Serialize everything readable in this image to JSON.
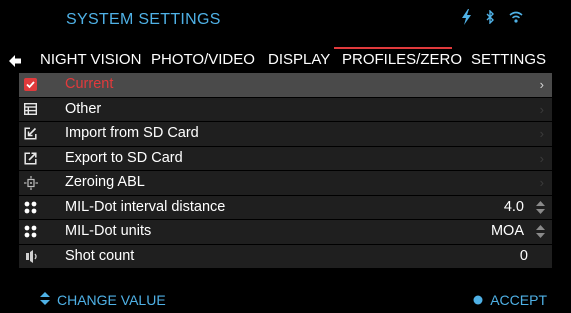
{
  "header": {
    "title": "SYSTEM SETTINGS",
    "status_icons": [
      "power-bolt-icon",
      "bluetooth-icon",
      "wifi-icon"
    ],
    "accent_color": "#4fb1e6"
  },
  "tabs": [
    {
      "label": "NIGHT VISION",
      "active": false
    },
    {
      "label": "PHOTO/VIDEO",
      "active": false
    },
    {
      "label": "DISPLAY",
      "active": false
    },
    {
      "label": "PROFILES/ZERO",
      "active": true
    },
    {
      "label": "SETTINGS",
      "active": false
    }
  ],
  "active_tab_color": "#e13a3c",
  "rows": [
    {
      "icon": "checkbox-checked-icon",
      "label": "Current",
      "selected": true,
      "chevron": true
    },
    {
      "icon": "list-table-icon",
      "label": "Other",
      "chevron": true
    },
    {
      "icon": "import-icon",
      "label": "Import from SD Card",
      "chevron": true
    },
    {
      "icon": "export-icon",
      "label": "Export to SD Card",
      "chevron": true
    },
    {
      "icon": "crosshair-icon",
      "label": "Zeroing ABL",
      "chevron": true
    },
    {
      "icon": "dots-grid-icon",
      "label": "MIL-Dot interval distance",
      "value": "4.0",
      "stepper": true
    },
    {
      "icon": "dots-grid-icon",
      "label": "MIL-Dot units",
      "value": "MOA",
      "stepper": true
    },
    {
      "icon": "shot-icon",
      "label": "Shot count",
      "value": "0"
    }
  ],
  "footer": {
    "change_value_label": "CHANGE VALUE",
    "accept_label": "ACCEPT"
  }
}
